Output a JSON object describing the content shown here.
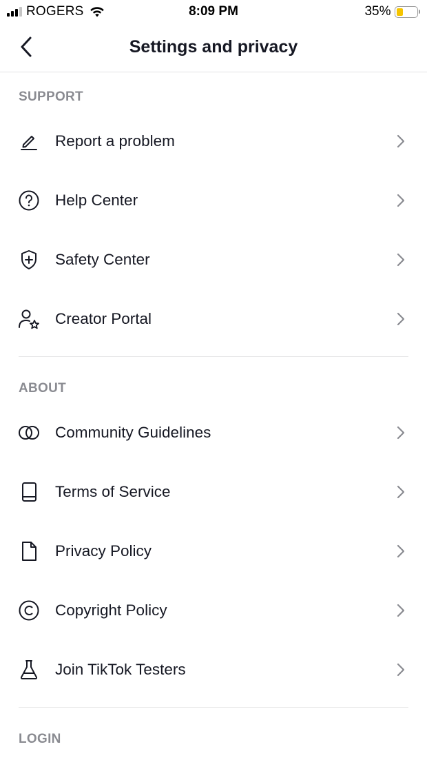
{
  "status_bar": {
    "carrier": "ROGERS",
    "time": "8:09 PM",
    "battery_percent": "35%",
    "battery_level": 0.35,
    "battery_color": "#f5c400",
    "signal_bars_filled": 3,
    "signal_bars_total": 4
  },
  "nav": {
    "title": "Settings and privacy",
    "back_icon": "chevron-left-icon"
  },
  "sections": [
    {
      "header": "SUPPORT",
      "items": [
        {
          "label": "Report a problem",
          "icon": "pencil-icon"
        },
        {
          "label": "Help Center",
          "icon": "question-circle-icon"
        },
        {
          "label": "Safety Center",
          "icon": "shield-plus-icon"
        },
        {
          "label": "Creator Portal",
          "icon": "user-star-icon"
        }
      ]
    },
    {
      "header": "ABOUT",
      "items": [
        {
          "label": "Community Guidelines",
          "icon": "overlapping-circles-icon"
        },
        {
          "label": "Terms of Service",
          "icon": "book-icon"
        },
        {
          "label": "Privacy Policy",
          "icon": "document-icon"
        },
        {
          "label": "Copyright Policy",
          "icon": "copyright-icon"
        },
        {
          "label": "Join TikTok Testers",
          "icon": "flask-icon"
        }
      ]
    },
    {
      "header": "LOGIN",
      "items": []
    }
  ],
  "colors": {
    "text_primary": "#161823",
    "section_header": "#8a8b91",
    "divider": "#e6e6e7",
    "chevron": "#8a8b91"
  }
}
